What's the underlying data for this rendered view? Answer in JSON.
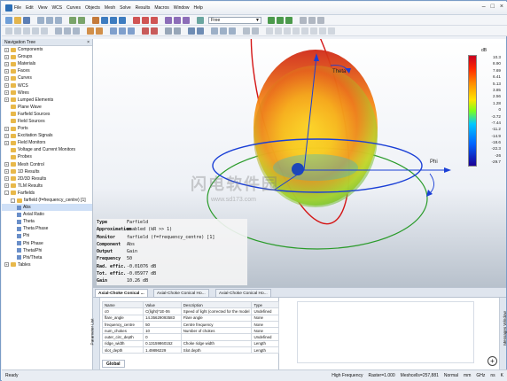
{
  "menu": [
    "File",
    "Edit",
    "View",
    "WCS",
    "Curves",
    "Objects",
    "Mesh",
    "Solve",
    "Results",
    "Macros",
    "Window",
    "Help"
  ],
  "toolbar": {
    "mode_combo": "Free"
  },
  "nav": {
    "title": "Navigation Tree",
    "items": [
      {
        "label": "Components",
        "kind": "folder",
        "exp": "+"
      },
      {
        "label": "Groups",
        "kind": "folder",
        "exp": "+"
      },
      {
        "label": "Materials",
        "kind": "folder",
        "exp": "+"
      },
      {
        "label": "Faces",
        "kind": "folder",
        "exp": "+"
      },
      {
        "label": "Curves",
        "kind": "folder",
        "exp": "+"
      },
      {
        "label": "WCS",
        "kind": "folder",
        "exp": "+"
      },
      {
        "label": "Wires",
        "kind": "folder",
        "exp": "+"
      },
      {
        "label": "Lumped Elements",
        "kind": "folder",
        "exp": "+"
      },
      {
        "label": "Plane Wave",
        "kind": "folder",
        "exp": ""
      },
      {
        "label": "Farfield Sources",
        "kind": "folder",
        "exp": ""
      },
      {
        "label": "Field Sources",
        "kind": "folder",
        "exp": ""
      },
      {
        "label": "Ports",
        "kind": "folder",
        "exp": "+"
      },
      {
        "label": "Excitation Signals",
        "kind": "folder",
        "exp": "+"
      },
      {
        "label": "Field Monitors",
        "kind": "folder",
        "exp": "+"
      },
      {
        "label": "Voltage and Current Monitors",
        "kind": "folder",
        "exp": ""
      },
      {
        "label": "Probes",
        "kind": "folder",
        "exp": ""
      },
      {
        "label": "Mesh Control",
        "kind": "folder",
        "exp": "+"
      },
      {
        "label": "1D Results",
        "kind": "folder",
        "exp": "+"
      },
      {
        "label": "2D/3D Results",
        "kind": "folder",
        "exp": "+"
      },
      {
        "label": "TLM Results",
        "kind": "folder",
        "exp": "+"
      },
      {
        "label": "Farfields",
        "kind": "folder",
        "exp": "-"
      },
      {
        "label": "farfield (f=frequency_centre) [1]",
        "kind": "folder",
        "exp": "-",
        "indent": 1
      },
      {
        "label": "Abs",
        "kind": "leaf",
        "indent": 2,
        "selected": true
      },
      {
        "label": "Axial Ratio",
        "kind": "leaf",
        "indent": 2
      },
      {
        "label": "Theta",
        "kind": "leaf",
        "indent": 2
      },
      {
        "label": "Theta Phase",
        "kind": "leaf",
        "indent": 2
      },
      {
        "label": "Phi",
        "kind": "leaf",
        "indent": 2
      },
      {
        "label": "Phi Phase",
        "kind": "leaf",
        "indent": 2
      },
      {
        "label": "Theta/Phi",
        "kind": "leaf",
        "indent": 2
      },
      {
        "label": "Phi/Theta",
        "kind": "leaf",
        "indent": 2
      },
      {
        "label": "Tables",
        "kind": "folder",
        "exp": "+"
      }
    ]
  },
  "legend": {
    "unit": "dB",
    "values": [
      "10.3",
      "8.90",
      "7.69",
      "6.41",
      "5.13",
      "3.85",
      "2.56",
      "1.28",
      "0",
      "-3.72",
      "-7.44",
      "-11.2",
      "-14.9",
      "-18.6",
      "-22.3",
      "-26",
      "-29.7"
    ]
  },
  "axes": {
    "theta": "Theta",
    "phi": "Phi"
  },
  "info": [
    {
      "k": "Type",
      "v": "Farfield"
    },
    {
      "k": "Approximation",
      "v": "enabled (kR >> 1)"
    },
    {
      "k": "Monitor",
      "v": "farfield (f=frequency_centre) [1]"
    },
    {
      "k": "Component",
      "v": "Abs"
    },
    {
      "k": "Output",
      "v": "Gain"
    },
    {
      "k": "Frequency",
      "v": "50"
    },
    {
      "k": "Rad. effic.",
      "v": "-0.01076 dB"
    },
    {
      "k": "Tot. effic.",
      "v": "-0.05977 dB"
    },
    {
      "k": "Gain",
      "v": "10.26 dB"
    }
  ],
  "watermark": {
    "main": "闪电软件园",
    "url": "www.sd173.com"
  },
  "tabs": [
    "Axial-Choke Conical ...",
    "Axial-Choke Conical Ho...",
    "Axial-Choke Conical Ho..."
  ],
  "params": {
    "side_label": "Parameter List",
    "headers": [
      "Name",
      "Value",
      "Description",
      "Type"
    ],
    "rows": [
      [
        "c0",
        "C(light)*1E-06",
        "Speed of light (corrected for the model",
        "Undefined"
      ],
      [
        "flare_angle",
        "14.35629093583",
        "Flare angle",
        "None"
      ],
      [
        "frequency_centre",
        "50",
        "Centre frequency",
        "None"
      ],
      [
        "num_chokes",
        "10",
        "Number of chokes",
        "None"
      ],
      [
        "outer_circ_depth",
        "0",
        "",
        "Undefined"
      ],
      [
        "ridge_width",
        "0.13159860152",
        "Choke ridge width",
        "Length"
      ],
      [
        "slot_depth",
        "1.49896229",
        "Slot depth",
        "Length"
      ]
    ],
    "global_tab": "Global"
  },
  "messages": {
    "side_label": "Messages Window"
  },
  "status": {
    "left": "Ready",
    "right": [
      "High Frequency",
      "Raster=1.000",
      "Meshcells=257,881",
      "Normal",
      "mm",
      "GHz",
      "ns",
      "K"
    ]
  }
}
